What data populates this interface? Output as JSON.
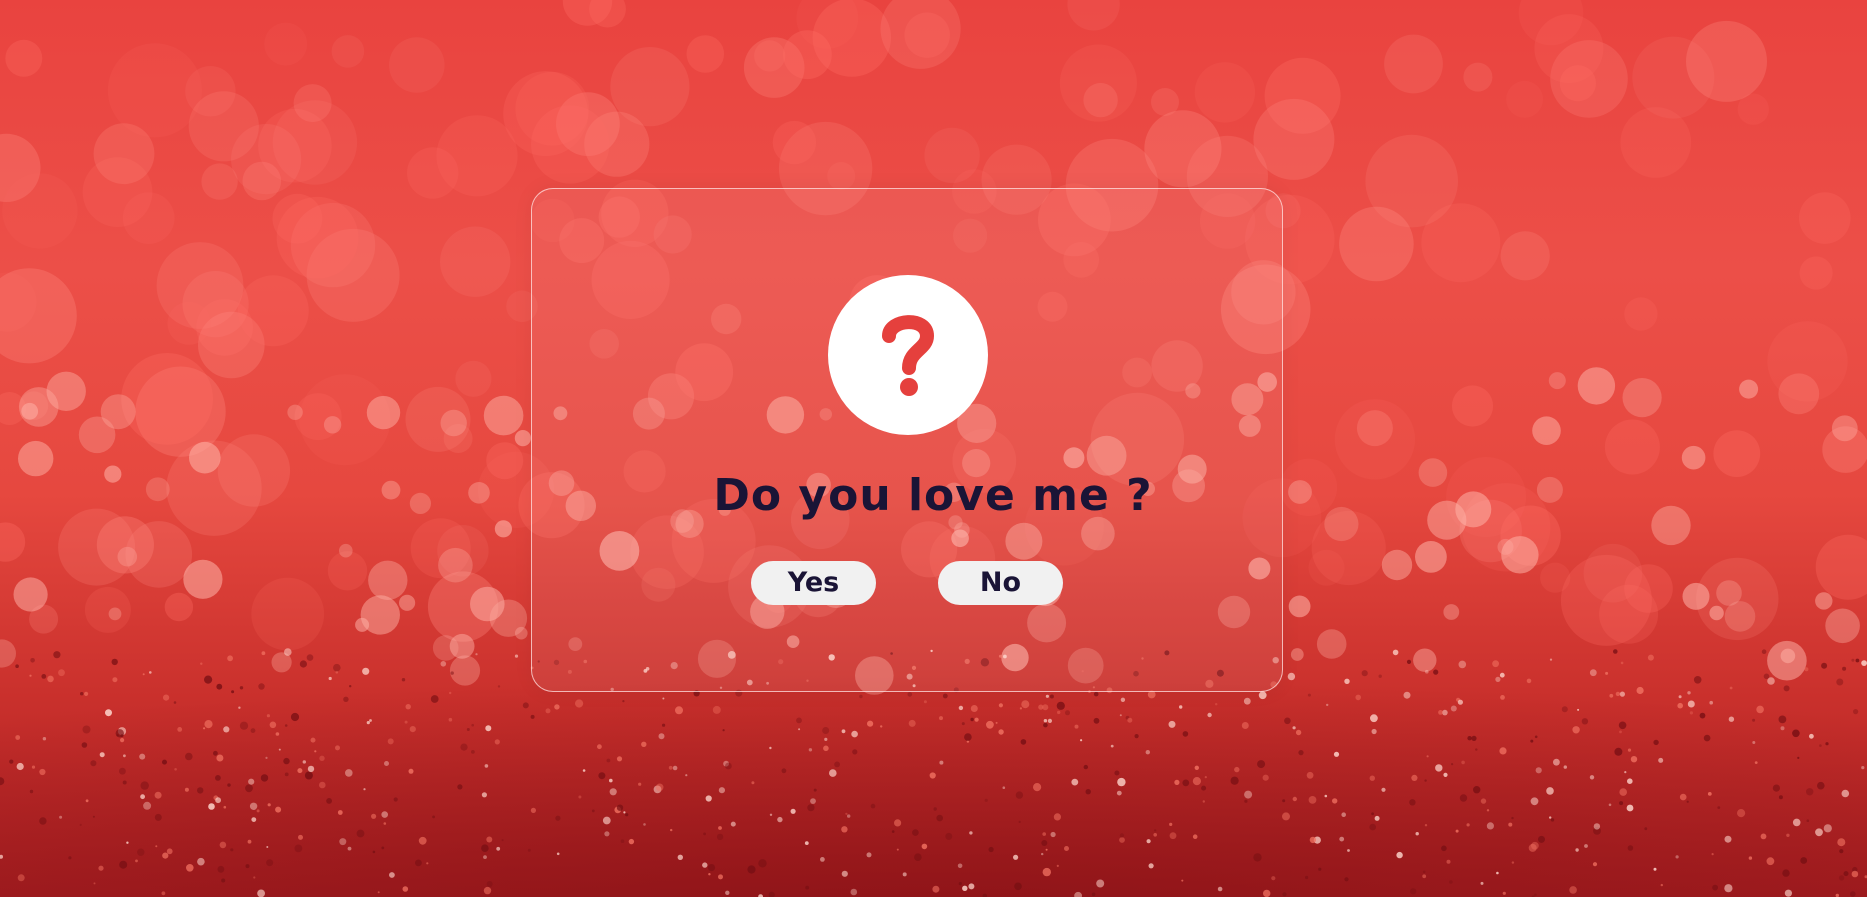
{
  "dialog": {
    "question": "Do you love me ?",
    "icon": "question-mark-icon",
    "buttons": {
      "yes_label": "Yes",
      "no_label": "No"
    }
  },
  "colors": {
    "background_red": "#e9433f",
    "icon_red": "#e5403d",
    "text_dark": "#1a1436",
    "button_bg": "#f1f1f1"
  }
}
